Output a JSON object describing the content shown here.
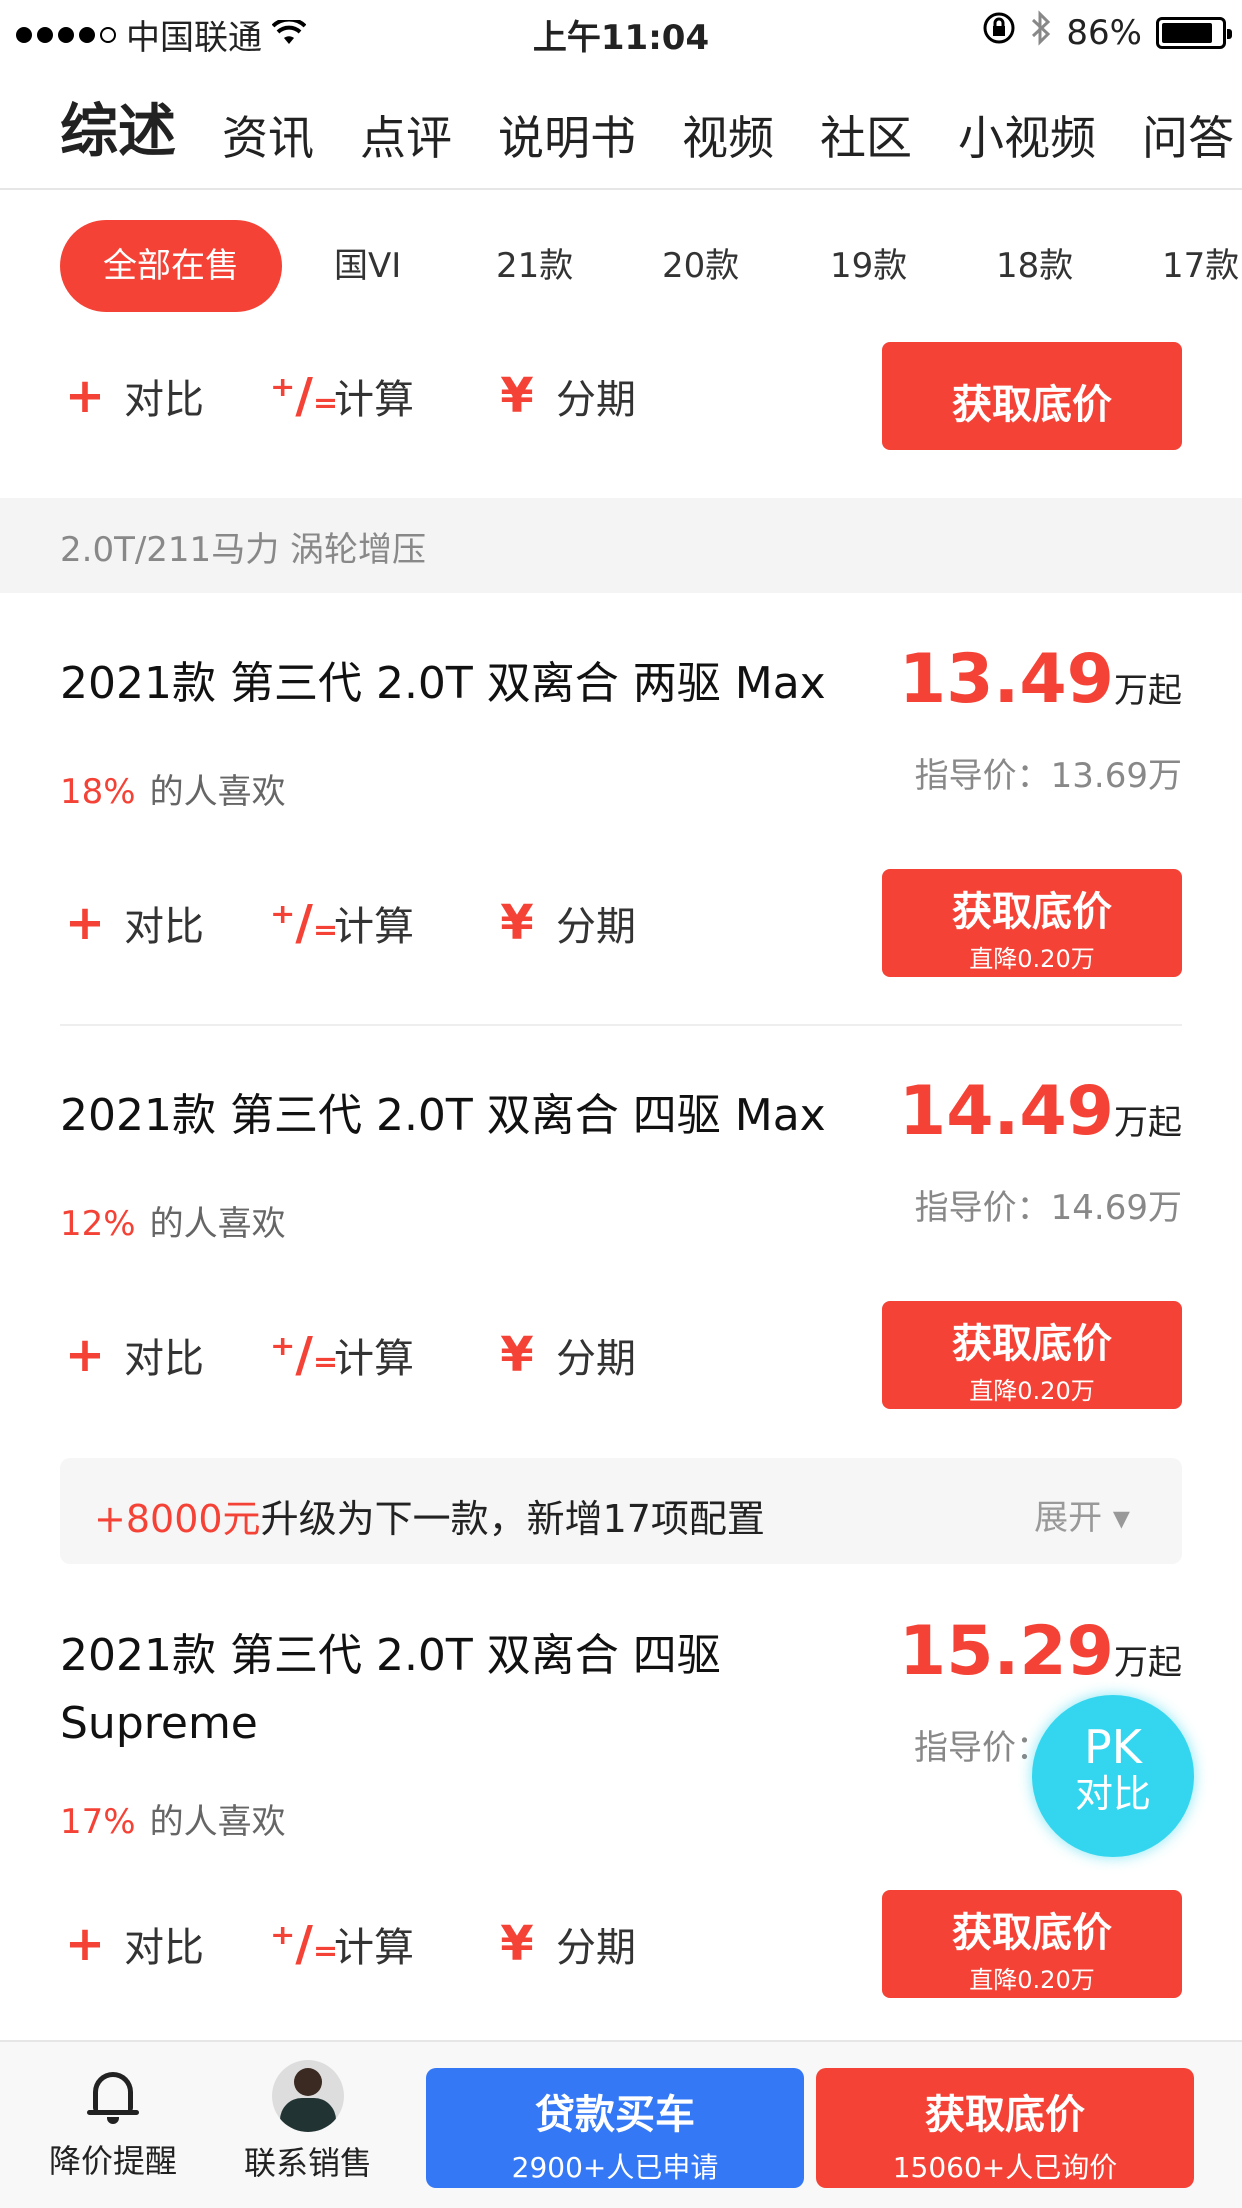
{
  "status_bar": {
    "carrier": "中国联通",
    "time": "上午11:04",
    "battery": "86%",
    "battery_level": 0.86
  },
  "top_tabs": [
    "综述",
    "资讯",
    "点评",
    "说明书",
    "视频",
    "社区",
    "小视频",
    "问答"
  ],
  "year_filters": [
    "全部在售",
    "国VI",
    "21款",
    "20款",
    "19款",
    "18款",
    "17款"
  ],
  "actions": {
    "compare": "对比",
    "calculate": "计算",
    "installment": "分期"
  },
  "price_button": {
    "label": "获取底价",
    "discount": "直降0.20万"
  },
  "engine_group": "2.0T/211马力 涡轮增压",
  "cars": [
    {
      "title": "2021款 第三代 2.0T 双离合 两驱 Max",
      "price": "13.49",
      "unit": "万起",
      "guide": "指导价：13.69万",
      "likes_pct": "18%",
      "likes_text": "的人喜欢"
    },
    {
      "title": "2021款 第三代 2.0T 双离合 四驱 Max",
      "price": "14.49",
      "unit": "万起",
      "guide": "指导价：14.69万",
      "likes_pct": "12%",
      "likes_text": "的人喜欢"
    },
    {
      "title": "2021款 第三代 2.0T 双离合 四驱 Supreme",
      "price": "15.29",
      "unit": "万起",
      "guide": "指导价：",
      "likes_pct": "17%",
      "likes_text": "的人喜欢"
    }
  ],
  "upgrade": {
    "amount": "+8000元",
    "text": "升级为下一款，新增17项配置",
    "expand": "展开"
  },
  "pk_float": {
    "line1": "PK",
    "line2": "对比"
  },
  "bottom_bar": {
    "alert": "降价提醒",
    "contact": "联系销售",
    "loan": {
      "label": "贷款买车",
      "sub": "2900+人已申请",
      "color": "#3478f6"
    },
    "quote": {
      "label": "获取底价",
      "sub": "15060+人已询价",
      "color": "#f44336"
    }
  },
  "colors": {
    "accent": "#f44336",
    "pk": "#33d6ee"
  }
}
